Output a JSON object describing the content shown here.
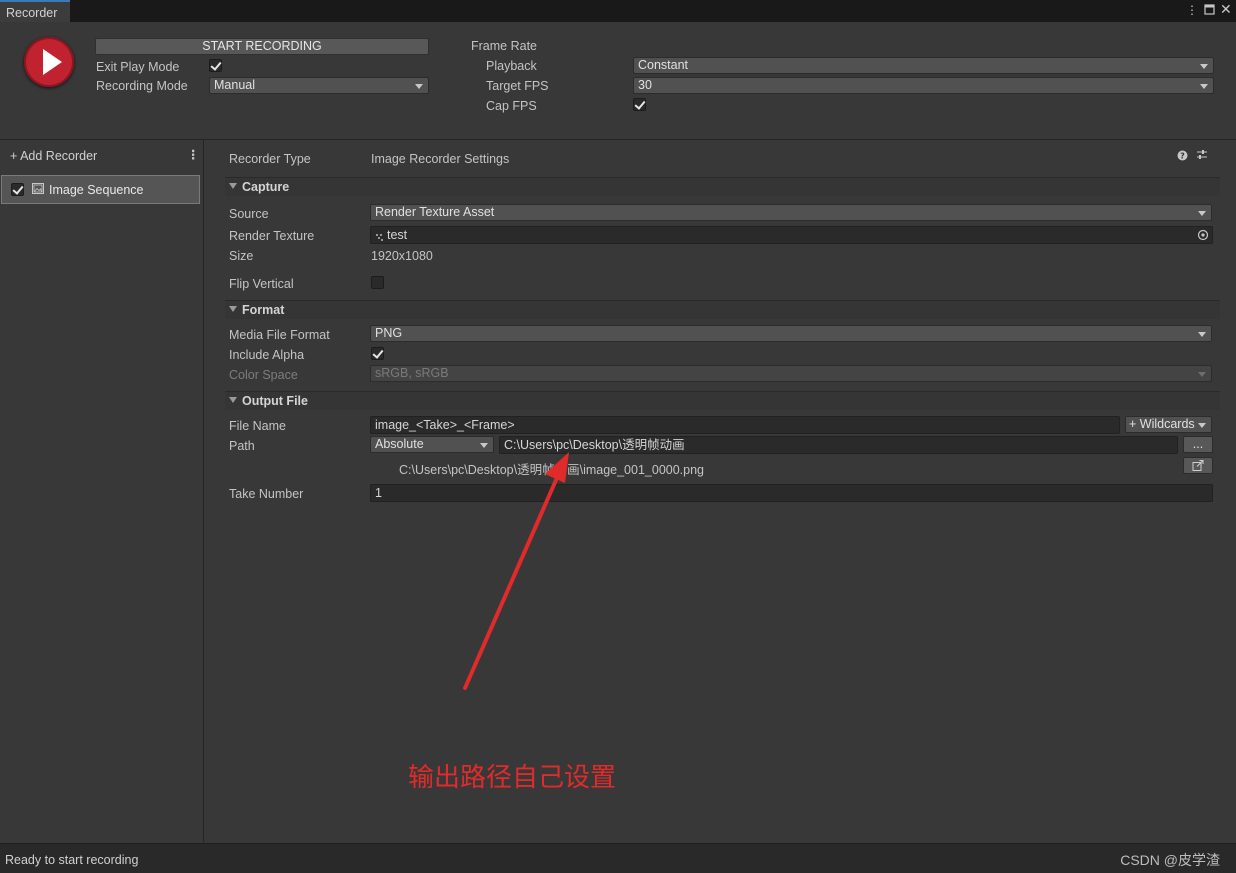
{
  "window": {
    "tab_title": "Recorder",
    "menu_icon": "kebab-menu-icon",
    "maximize_icon": "maximize-icon",
    "close_icon": "close-icon"
  },
  "header": {
    "start_label": "START RECORDING",
    "exit_play_mode_label": "Exit Play Mode",
    "exit_play_mode_checked": true,
    "recording_mode_label": "Recording Mode",
    "recording_mode_value": "Manual",
    "frame_rate_label": "Frame Rate",
    "playback_label": "Playback",
    "playback_value": "Constant",
    "target_fps_label": "Target FPS",
    "target_fps_value": "30",
    "cap_fps_label": "Cap FPS",
    "cap_fps_checked": true
  },
  "sidebar": {
    "add_label": "+ Add Recorder",
    "menu_glyph": "⋮",
    "items": [
      {
        "label": "Image Sequence",
        "enabled": true
      }
    ]
  },
  "main": {
    "recorder_type_label": "Recorder Type",
    "recorder_type_value": "Image Recorder Settings",
    "capture": {
      "title": "Capture",
      "source_label": "Source",
      "source_value": "Render Texture Asset",
      "render_texture_label": "Render Texture",
      "render_texture_value": "test",
      "size_label": "Size",
      "size_value": "1920x1080",
      "flip_vertical_label": "Flip Vertical",
      "flip_vertical_checked": false
    },
    "format": {
      "title": "Format",
      "media_file_format_label": "Media File Format",
      "media_file_format_value": "PNG",
      "include_alpha_label": "Include Alpha",
      "include_alpha_checked": true,
      "color_space_label": "Color Space",
      "color_space_value": "sRGB, sRGB"
    },
    "output": {
      "title": "Output File",
      "file_name_label": "File Name",
      "file_name_value": "image_<Take>_<Frame>",
      "wildcards_label": "+ Wildcards",
      "path_label": "Path",
      "path_type_value": "Absolute",
      "path_value": "C:\\Users\\pc\\Desktop\\透明帧动画",
      "browse_label": "...",
      "resolved_path": "C:\\Users\\pc\\Desktop\\透明帧动画\\image_001_0000.png",
      "take_number_label": "Take Number",
      "take_number_value": "1"
    }
  },
  "annotation": {
    "text": "输出路径自己设置",
    "color": "#e12a2a"
  },
  "status": {
    "text": "Ready to start recording"
  },
  "watermark": "CSDN @皮学渣",
  "colors": {
    "record_red": "#c1222f",
    "selected_tab_accent": "#3a79bb"
  }
}
